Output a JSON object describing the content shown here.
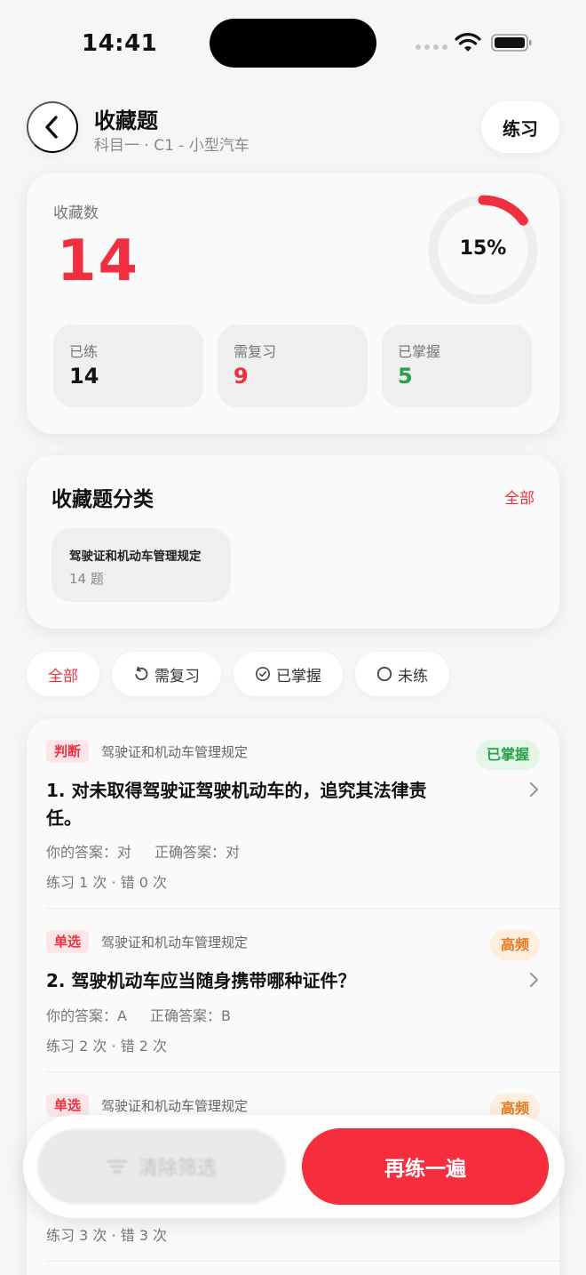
{
  "status_bar": {
    "time": "14:41"
  },
  "header": {
    "title": "收藏题",
    "subtitle": "科目一 · C1 - 小型汽车",
    "practice_label": "练习"
  },
  "stats": {
    "label": "收藏数",
    "total": "14",
    "percent_label": "15%",
    "percent_value": 0.15,
    "items": [
      {
        "label": "已练",
        "value": "14",
        "color": "#111111"
      },
      {
        "label": "需复习",
        "value": "9",
        "color": "#f0303f"
      },
      {
        "label": "已掌握",
        "value": "5",
        "color": "#27a14a"
      }
    ]
  },
  "categories": {
    "title": "收藏题分类",
    "all_label": "全部",
    "items": [
      {
        "name": "驾驶证和机动车管理规定",
        "count": "14 题"
      }
    ]
  },
  "filters": [
    {
      "label": "全部",
      "icon": "",
      "active": true
    },
    {
      "label": "需复习",
      "icon": "rotate-left-icon",
      "active": false
    },
    {
      "label": "已掌握",
      "icon": "check-circle-icon",
      "active": false
    },
    {
      "label": "未练",
      "icon": "circle-icon",
      "active": false
    }
  ],
  "questions": [
    {
      "type": "判断",
      "category": "驾驶证和机动车管理规定",
      "badge": "已掌握",
      "badge_color": "green",
      "text": "1. 对未取得驾驶证驾驶机动车的，追究其法律责任。",
      "your_answer": "你的答案：对",
      "correct_answer": "正确答案：对",
      "stats": "练习 1 次 · 错 0 次"
    },
    {
      "type": "单选",
      "category": "驾驶证和机动车管理规定",
      "badge": "高频",
      "badge_color": "orange",
      "text": "2. 驾驶机动车应当随身携带哪种证件？",
      "your_answer": "你的答案：A",
      "correct_answer": "正确答案：B",
      "stats": "练习 2 次 · 错 2 次"
    },
    {
      "type": "单选",
      "category": "驾驶证和机动车管理规定",
      "badge": "高频",
      "badge_color": "orange",
      "text": "",
      "your_answer": "",
      "correct_answer": "",
      "stats": "练习 3 次 · 错 3 次"
    }
  ],
  "bottom": {
    "clear_label": "清除筛选",
    "redo_label": "再练一遍"
  },
  "colors": {
    "accent": "#f0303f",
    "success": "#27a14a",
    "warning": "#ea7a1e"
  }
}
